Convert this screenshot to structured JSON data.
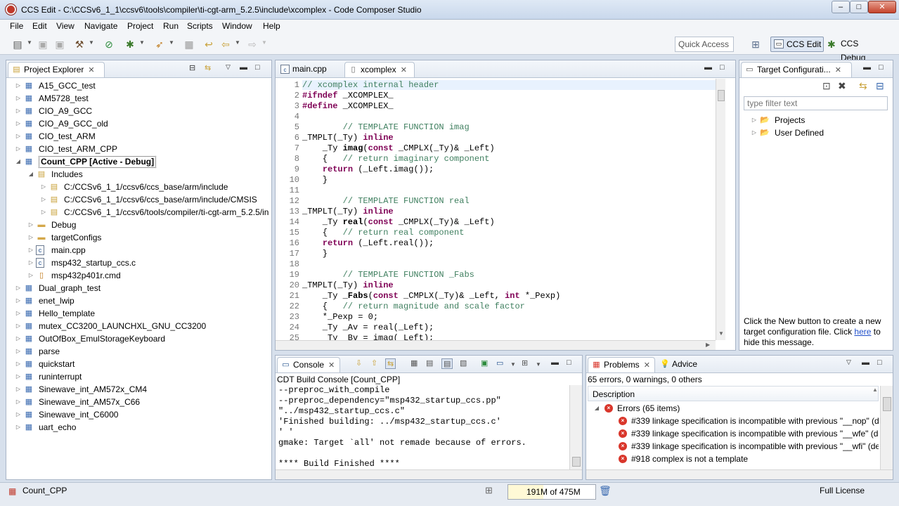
{
  "window": {
    "title": "CCS Edit - C:\\CCSv6_1_1\\ccsv6\\tools\\compiler\\ti-cgt-arm_5.2.5\\include\\xcomplex - Code Composer Studio",
    "minimize": "–",
    "maximize": "□",
    "close": "✕"
  },
  "menu": [
    "File",
    "Edit",
    "View",
    "Navigate",
    "Project",
    "Run",
    "Scripts",
    "Window",
    "Help"
  ],
  "toolbar": {
    "quick_access_placeholder": "Quick Access",
    "perspective_edit": "CCS Edit",
    "perspective_debug": "CCS Debug"
  },
  "project_explorer": {
    "title": "Project Explorer",
    "items": [
      {
        "label": "A15_GCC_test",
        "level": 0,
        "arrow": "▷",
        "icon": "project"
      },
      {
        "label": "AM5728_test",
        "level": 0,
        "arrow": "▷",
        "icon": "project"
      },
      {
        "label": "CIO_A9_GCC",
        "level": 0,
        "arrow": "▷",
        "icon": "project"
      },
      {
        "label": "CIO_A9_GCC_old",
        "level": 0,
        "arrow": "▷",
        "icon": "project"
      },
      {
        "label": "CIO_test_ARM",
        "level": 0,
        "arrow": "▷",
        "icon": "project"
      },
      {
        "label": "CIO_test_ARM_CPP",
        "level": 0,
        "arrow": "▷",
        "icon": "project"
      },
      {
        "label": "Count_CPP  [Active - Debug]",
        "level": 0,
        "arrow": "◢",
        "icon": "project",
        "bold": true,
        "selected": true
      },
      {
        "label": "Includes",
        "level": 1,
        "arrow": "◢",
        "icon": "includes"
      },
      {
        "label": "C:/CCSv6_1_1/ccsv6/ccs_base/arm/include",
        "level": 2,
        "arrow": "▷",
        "icon": "folder-inc"
      },
      {
        "label": "C:/CCSv6_1_1/ccsv6/ccs_base/arm/include/CMSIS",
        "level": 2,
        "arrow": "▷",
        "icon": "folder-inc"
      },
      {
        "label": "C:/CCSv6_1_1/ccsv6/tools/compiler/ti-cgt-arm_5.2.5/in",
        "level": 2,
        "arrow": "▷",
        "icon": "folder-inc"
      },
      {
        "label": "Debug",
        "level": 1,
        "arrow": "▷",
        "icon": "folder"
      },
      {
        "label": "targetConfigs",
        "level": 1,
        "arrow": "▷",
        "icon": "folder"
      },
      {
        "label": "main.cpp",
        "level": 1,
        "arrow": "▷",
        "icon": "cpp"
      },
      {
        "label": "msp432_startup_ccs.c",
        "level": 1,
        "arrow": "▷",
        "icon": "c"
      },
      {
        "label": "msp432p401r.cmd",
        "level": 1,
        "arrow": "▷",
        "icon": "cmd"
      },
      {
        "label": "Dual_graph_test",
        "level": 0,
        "arrow": "▷",
        "icon": "project"
      },
      {
        "label": "enet_lwip",
        "level": 0,
        "arrow": "▷",
        "icon": "project"
      },
      {
        "label": "Hello_template",
        "level": 0,
        "arrow": "▷",
        "icon": "project"
      },
      {
        "label": "mutex_CC3200_LAUNCHXL_GNU_CC3200",
        "level": 0,
        "arrow": "▷",
        "icon": "project"
      },
      {
        "label": "OutOfBox_EmulStorageKeyboard",
        "level": 0,
        "arrow": "▷",
        "icon": "project"
      },
      {
        "label": "parse",
        "level": 0,
        "arrow": "▷",
        "icon": "project"
      },
      {
        "label": "quickstart",
        "level": 0,
        "arrow": "▷",
        "icon": "project"
      },
      {
        "label": "runinterrupt",
        "level": 0,
        "arrow": "▷",
        "icon": "project"
      },
      {
        "label": "Sinewave_int_AM572x_CM4",
        "level": 0,
        "arrow": "▷",
        "icon": "project"
      },
      {
        "label": "Sinewave_int_AM57x_C66",
        "level": 0,
        "arrow": "▷",
        "icon": "project"
      },
      {
        "label": "Sinewave_int_C6000",
        "level": 0,
        "arrow": "▷",
        "icon": "project"
      },
      {
        "label": "uart_echo",
        "level": 0,
        "arrow": "▷",
        "icon": "project"
      }
    ]
  },
  "editor": {
    "tabs": [
      {
        "label": "main.cpp",
        "active": false
      },
      {
        "label": "xcomplex",
        "active": true
      }
    ],
    "lines": [
      {
        "n": "1",
        "t": "// xcomplex internal header",
        "c": "cm"
      },
      {
        "n": "2",
        "t": "#ifndef _XCOMPLEX_",
        "c": "pp"
      },
      {
        "n": "3",
        "t": "#define _XCOMPLEX_",
        "c": "pp"
      },
      {
        "n": "4",
        "t": "",
        "c": ""
      },
      {
        "n": "5",
        "t": "        // TEMPLATE FUNCTION imag",
        "c": "cm"
      },
      {
        "n": "6",
        "t": "_TMPLT(_Ty) inline",
        "c": "tm"
      },
      {
        "n": "7",
        "t": "    _Ty imag(const _CMPLX(_Ty)& _Left)",
        "c": "fd"
      },
      {
        "n": "8",
        "t": "    {   // return imaginary component",
        "c": "bc"
      },
      {
        "n": "9",
        "t": "    return (_Left.imag());",
        "c": "rt"
      },
      {
        "n": "10",
        "t": "    }",
        "c": ""
      },
      {
        "n": "11",
        "t": "",
        "c": ""
      },
      {
        "n": "12",
        "t": "        // TEMPLATE FUNCTION real",
        "c": "cm"
      },
      {
        "n": "13",
        "t": "_TMPLT(_Ty) inline",
        "c": "tm"
      },
      {
        "n": "14",
        "t": "    _Ty real(const _CMPLX(_Ty)& _Left)",
        "c": "fd"
      },
      {
        "n": "15",
        "t": "    {   // return real component",
        "c": "bc"
      },
      {
        "n": "16",
        "t": "    return (_Left.real());",
        "c": "rt"
      },
      {
        "n": "17",
        "t": "    }",
        "c": ""
      },
      {
        "n": "18",
        "t": "",
        "c": ""
      },
      {
        "n": "19",
        "t": "        // TEMPLATE FUNCTION _Fabs",
        "c": "cm"
      },
      {
        "n": "20",
        "t": "_TMPLT(_Ty) inline",
        "c": "tm"
      },
      {
        "n": "21",
        "t": "    _Ty _Fabs(const _CMPLX(_Ty)& _Left, int *_Pexp)",
        "c": "fd"
      },
      {
        "n": "22",
        "t": "    {   // return magnitude and scale factor",
        "c": "bc"
      },
      {
        "n": "23",
        "t": "    *_Pexp = 0;",
        "c": ""
      },
      {
        "n": "24",
        "t": "    _Ty _Av = real(_Left);",
        "c": ""
      },
      {
        "n": "25",
        "t": "    _Ty _Bv = imag(_Left);",
        "c": ""
      }
    ]
  },
  "target_config": {
    "title": "Target Configurati...",
    "filter_placeholder": "type filter text",
    "items": [
      "Projects",
      "User Defined"
    ],
    "hint_before": "Click the New button to create a new target configuration file. Click ",
    "hint_link": "here",
    "hint_after": " to hide this message."
  },
  "console": {
    "title": "Console",
    "subtitle": "CDT Build Console [Count_CPP]",
    "lines": [
      "--preproc_with_compile",
      "--preproc_dependency=\"msp432_startup_ccs.pp\"",
      "\"../msp432_startup_ccs.c\"",
      "'Finished building: ../msp432_startup_ccs.c'",
      "' '",
      "gmake: Target `all' not remade because of errors.",
      "",
      "**** Build Finished ****"
    ]
  },
  "problems": {
    "title": "Problems",
    "advice_title": "Advice",
    "summary": "65 errors, 0 warnings, 0 others",
    "column": "Description",
    "group": "Errors (65 items)",
    "errors": [
      "#339 linkage specification is incompatible with previous \"__nop\" (de",
      "#339 linkage specification is incompatible with previous \"__wfe\" (de",
      "#339 linkage specification is incompatible with previous \"__wfi\" (de",
      "#918 complex is not a template"
    ]
  },
  "status": {
    "project": "Count_CPP",
    "heap": "191M of 475M",
    "heap_used_fraction": 0.4,
    "license": "Full License"
  }
}
